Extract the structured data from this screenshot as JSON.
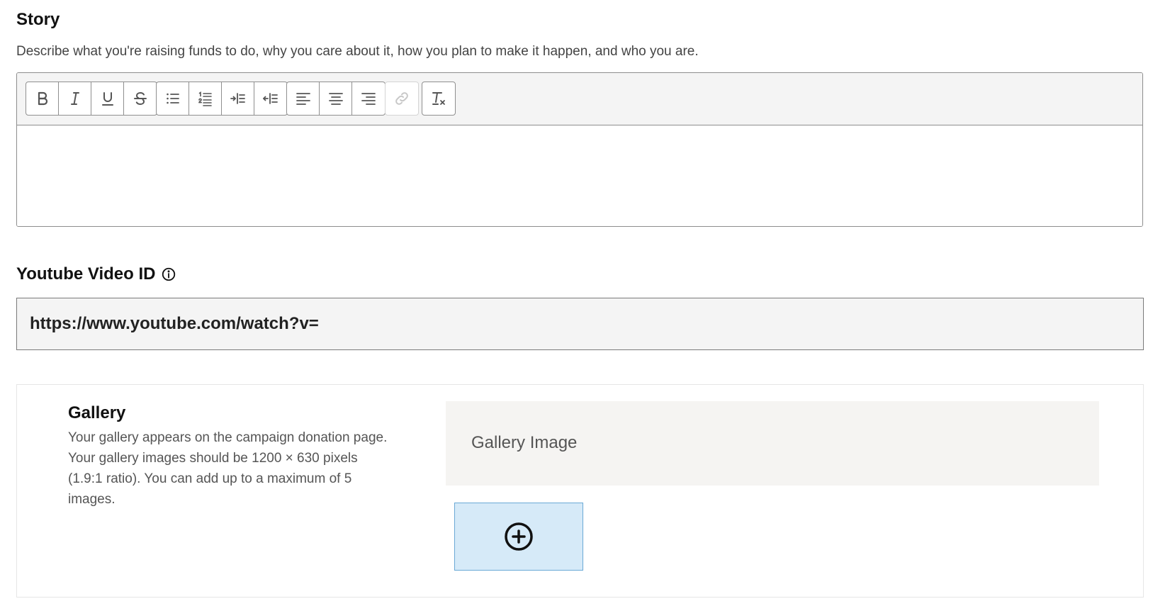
{
  "story": {
    "title": "Story",
    "description": "Describe what you're raising funds to do, why you care about it, how you plan to make it happen, and who you are.",
    "toolbar": {
      "groups": [
        {
          "disabled": false,
          "buttons": [
            {
              "icon": "bold-icon"
            },
            {
              "icon": "italic-icon"
            },
            {
              "icon": "underline-icon"
            },
            {
              "icon": "strikethrough-icon"
            }
          ]
        },
        {
          "disabled": false,
          "buttons": [
            {
              "icon": "bullet-list-icon"
            },
            {
              "icon": "numbered-list-icon"
            },
            {
              "icon": "indent-icon"
            },
            {
              "icon": "outdent-icon"
            }
          ]
        },
        {
          "disabled": false,
          "buttons": [
            {
              "icon": "align-left-icon"
            },
            {
              "icon": "align-center-icon"
            },
            {
              "icon": "align-right-icon"
            }
          ]
        },
        {
          "disabled": true,
          "buttons": [
            {
              "icon": "link-icon"
            }
          ]
        },
        {
          "disabled": false,
          "buttons": [
            {
              "icon": "clear-format-icon"
            }
          ]
        }
      ]
    },
    "content": ""
  },
  "youtube": {
    "label": "Youtube Video ID",
    "info_icon": "info-icon",
    "value": "https://www.youtube.com/watch?v="
  },
  "gallery": {
    "title": "Gallery",
    "description": "Your gallery appears on the campaign donation page. Your gallery images should be 1200 × 630 pixels (1.9:1 ratio). You can add up to a maximum of 5 images.",
    "image_header": "Gallery Image",
    "add_icon": "plus-circle-icon"
  },
  "colors": {
    "toolbar_bg": "#f4f4f4",
    "input_bg": "#f4f4f4",
    "gallery_header_bg": "#f5f4f2",
    "add_tile_bg": "#d6eaf8",
    "add_tile_border": "#6aa9d6"
  }
}
